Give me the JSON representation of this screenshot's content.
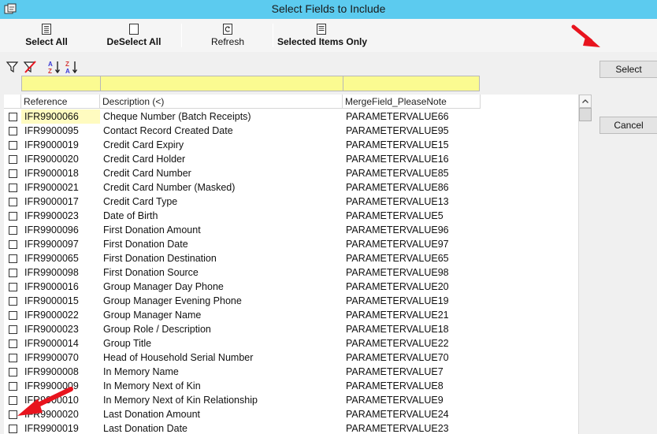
{
  "window": {
    "title": "Select Fields to Include"
  },
  "toolbar": {
    "select_all": "Select All",
    "deselect_all": "DeSelect All",
    "refresh": "Refresh",
    "selected_items_only": "Selected Items Only"
  },
  "side": {
    "select": "Select",
    "cancel": "Cancel"
  },
  "grid": {
    "columns": [
      "Reference",
      "Description (<)",
      "MergeField_PleaseNote"
    ],
    "rows": [
      {
        "ref": "IFR9900066",
        "desc": "Cheque Number (Batch Receipts)",
        "merge": "PARAMETERVALUE66"
      },
      {
        "ref": "IFR9900095",
        "desc": "Contact Record Created Date",
        "merge": "PARAMETERVALUE95"
      },
      {
        "ref": "IFR9000019",
        "desc": "Credit Card Expiry",
        "merge": "PARAMETERVALUE15"
      },
      {
        "ref": "IFR9000020",
        "desc": "Credit Card Holder",
        "merge": "PARAMETERVALUE16"
      },
      {
        "ref": "IFR9000018",
        "desc": "Credit Card Number",
        "merge": "PARAMETERVALUE85"
      },
      {
        "ref": "IFR9000021",
        "desc": "Credit Card Number (Masked)",
        "merge": "PARAMETERVALUE86"
      },
      {
        "ref": "IFR9000017",
        "desc": "Credit Card Type",
        "merge": "PARAMETERVALUE13"
      },
      {
        "ref": "IFR9900023",
        "desc": "Date of Birth",
        "merge": "PARAMETERVALUE5"
      },
      {
        "ref": "IFR9900096",
        "desc": "First Donation Amount",
        "merge": "PARAMETERVALUE96"
      },
      {
        "ref": "IFR9900097",
        "desc": "First Donation Date",
        "merge": "PARAMETERVALUE97"
      },
      {
        "ref": "IFR9900065",
        "desc": "First Donation Destination",
        "merge": "PARAMETERVALUE65"
      },
      {
        "ref": "IFR9900098",
        "desc": "First Donation Source",
        "merge": "PARAMETERVALUE98"
      },
      {
        "ref": "IFR9000016",
        "desc": "Group Manager Day Phone",
        "merge": "PARAMETERVALUE20"
      },
      {
        "ref": "IFR9000015",
        "desc": "Group Manager Evening Phone",
        "merge": "PARAMETERVALUE19"
      },
      {
        "ref": "IFR9000022",
        "desc": "Group Manager Name",
        "merge": "PARAMETERVALUE21"
      },
      {
        "ref": "IFR9000023",
        "desc": "Group Role / Description",
        "merge": "PARAMETERVALUE18"
      },
      {
        "ref": "IFR9000014",
        "desc": "Group Title",
        "merge": "PARAMETERVALUE22"
      },
      {
        "ref": "IFR9900070",
        "desc": "Head of Household Serial Number",
        "merge": "PARAMETERVALUE70"
      },
      {
        "ref": "IFR9900008",
        "desc": "In Memory Name",
        "merge": "PARAMETERVALUE7"
      },
      {
        "ref": "IFR9900009",
        "desc": "In Memory Next of Kin",
        "merge": "PARAMETERVALUE8"
      },
      {
        "ref": "IFR9900010",
        "desc": "In Memory Next of Kin Relationship",
        "merge": "PARAMETERVALUE9"
      },
      {
        "ref": "IFR9900020",
        "desc": "Last Donation Amount",
        "merge": "PARAMETERVALUE24"
      },
      {
        "ref": "IFR9900019",
        "desc": "Last Donation Date",
        "merge": "PARAMETERVALUE23"
      }
    ]
  },
  "colors": {
    "titlebar": "#5ccbef",
    "filter_row": "#fbfb91",
    "active_cell": "#fffbc0",
    "arrow": "#e8141e"
  },
  "icons": [
    "app-icon",
    "select-all-icon",
    "deselect-all-icon",
    "refresh-icon",
    "selected-items-icon",
    "filter-icon",
    "clear-filter-icon",
    "sort-ascending-icon",
    "sort-descending-icon",
    "red-arrow-icon"
  ]
}
